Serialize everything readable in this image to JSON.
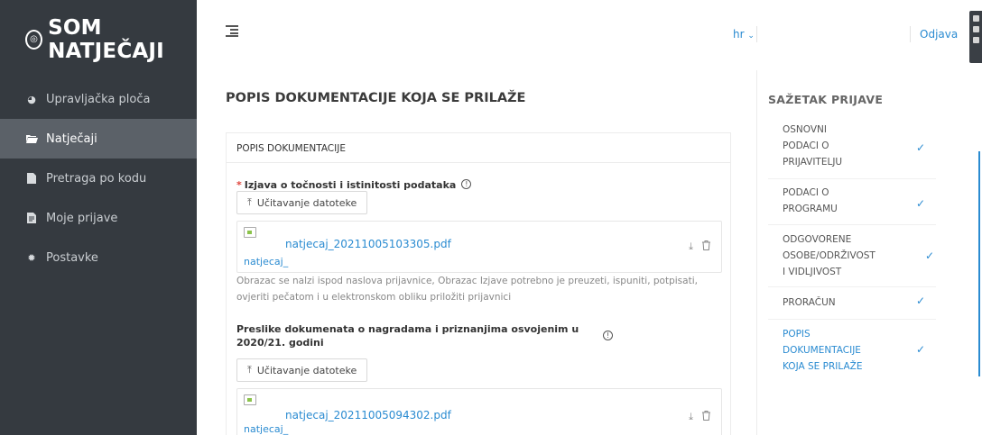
{
  "brand": {
    "logo_text": "SOM NATJEČAJI",
    "logo_icon": "eye-circle-icon"
  },
  "sidebar": {
    "items": [
      {
        "label": "Upravljačka ploča",
        "icon": "pie-chart-icon",
        "active": false
      },
      {
        "label": "Natječaji",
        "icon": "folder-open-icon",
        "active": true
      },
      {
        "label": "Pretraga po kodu",
        "icon": "file-icon",
        "active": false
      },
      {
        "label": "Moje prijave",
        "icon": "file-text-icon",
        "active": false
      },
      {
        "label": "Postavke",
        "icon": "gear-icon",
        "active": false
      }
    ]
  },
  "topbar": {
    "menu_icon": "menu-fold-icon",
    "language": "hr",
    "logout": "Odjava"
  },
  "main": {
    "title": "POPIS DOKUMENTACIJE KOJA SE PRILAŽE",
    "card_title": "POPIS DOKUMENTACIJE",
    "sections": [
      {
        "label": "Izjava o točnosti i istinitosti podataka",
        "required": true,
        "upload_label": "Učitavanje datoteke",
        "file_name": "natjecaj_20211005103305.pdf",
        "thumb_alt": "natjecaj_20211005103305.pdf",
        "hint": "Obrazac se nalzi ispod naslova prijavnice, Obrazac Izjave potrebno je preuzeti, ispuniti, potpisati, ovjeriti pečatom i u elektronskom obliku priložiti prijavnici"
      },
      {
        "label_line1": "Preslike dokumenata o nagradama i priznanjima osvojenim u",
        "label_line2": "2020/21. godini",
        "required": false,
        "upload_label": "Učitavanje datoteke",
        "file_name": "natjecaj_20211005094302.pdf",
        "thumb_alt": "natjecaj_20211005094302.pdf"
      }
    ]
  },
  "summary": {
    "title": "SAŽETAK PRIJAVE",
    "items": [
      {
        "lines": [
          "OSNOVNI",
          "PODACI O",
          "PRIJAVITELJU"
        ],
        "checked": true,
        "active": false
      },
      {
        "lines": [
          "PODACI O",
          "PROGRAMU"
        ],
        "checked": true,
        "active": false
      },
      {
        "lines": [
          "ODGOVORENE",
          "OSOBE/ODRŽIVOST",
          "I VIDLJIVOST"
        ],
        "checked": true,
        "active": false
      },
      {
        "lines": [
          "PRORAČUN"
        ],
        "checked": true,
        "active": false
      },
      {
        "lines": [
          "POPIS",
          "DOKUMENTACIJE",
          "KOJA SE PRILAŽE"
        ],
        "checked": true,
        "active": true
      }
    ]
  },
  "colors": {
    "sidebar_bg": "#353a40",
    "sidebar_active": "#5b6168",
    "accent": "#2a8bd1",
    "required": "#e0443c"
  }
}
